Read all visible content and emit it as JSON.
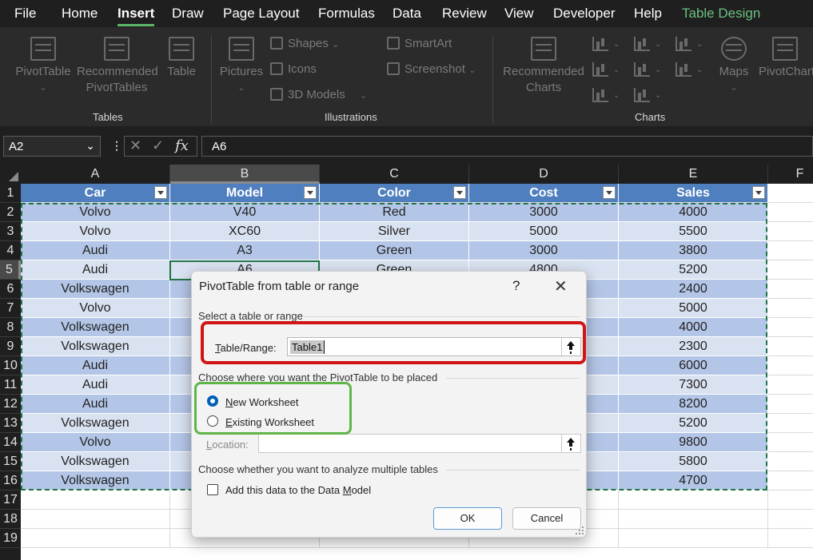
{
  "menu": {
    "tabs": [
      "File",
      "Home",
      "Insert",
      "Draw",
      "Page Layout",
      "Formulas",
      "Data",
      "Review",
      "View",
      "Developer",
      "Help",
      "Table Design"
    ],
    "active": "Insert"
  },
  "ribbon": {
    "pivottable_label": "PivotTable",
    "recommended_pivottables_line1": "Recommended",
    "recommended_pivottables_line2": "PivotTables",
    "table_label": "Table",
    "tables_group": "Tables",
    "pictures_label": "Pictures",
    "shapes_label": "Shapes",
    "icons_label": "Icons",
    "models_label": "3D Models",
    "smartart_label": "SmartArt",
    "screenshot_label": "Screenshot",
    "illustrations_group": "Illustrations",
    "recommended_charts_line1": "Recommended",
    "recommended_charts_line2": "Charts",
    "maps_label": "Maps",
    "pivotchart_label": "PivotChart",
    "charts_group": "Charts"
  },
  "formula_bar": {
    "name_box": "A2",
    "formula": "A6",
    "fx_label": "fx"
  },
  "sheet": {
    "columns": [
      "A",
      "B",
      "C",
      "D",
      "E",
      "F"
    ],
    "selected_column": "B",
    "rows": [
      "1",
      "2",
      "3",
      "4",
      "5",
      "6",
      "7",
      "8",
      "9",
      "10",
      "11",
      "12",
      "13",
      "14",
      "15",
      "16",
      "17",
      "18",
      "19"
    ],
    "selected_row": "5",
    "headers": [
      "Car",
      "Model",
      "Color",
      "Cost",
      "Sales"
    ],
    "data": [
      [
        "Volvo",
        "V40",
        "Red",
        "3000",
        "4000"
      ],
      [
        "Volvo",
        "XC60",
        "Silver",
        "5000",
        "5500"
      ],
      [
        "Audi",
        "A3",
        "Green",
        "3000",
        "3800"
      ],
      [
        "Audi",
        "A6",
        "Green",
        "4800",
        "5200"
      ],
      [
        "Volkswagen",
        "",
        "",
        "",
        "2400"
      ],
      [
        "Volvo",
        "",
        "",
        "",
        "5000"
      ],
      [
        "Volkswagen",
        "",
        "",
        "",
        "4000"
      ],
      [
        "Volkswagen",
        "",
        "",
        "",
        "2300"
      ],
      [
        "Audi",
        "",
        "",
        "",
        "6000"
      ],
      [
        "Audi",
        "",
        "",
        "",
        "7300"
      ],
      [
        "Audi",
        "",
        "",
        "",
        "8200"
      ],
      [
        "Volkswagen",
        "",
        "",
        "",
        "5200"
      ],
      [
        "Volvo",
        "",
        "",
        "",
        "9800"
      ],
      [
        "Volkswagen",
        "",
        "",
        "",
        "5800"
      ],
      [
        "Volkswagen",
        "",
        "",
        "",
        "4700"
      ]
    ]
  },
  "dialog": {
    "title": "PivotTable from table or range",
    "help": "?",
    "close": "✕",
    "section_select": "Select a table or range",
    "table_range_label": "Table/Range:",
    "table_range_value": "Table1",
    "section_place": "Choose where you want the PivotTable to be placed",
    "new_worksheet": "New Worksheet",
    "existing_worksheet": "Existing Worksheet",
    "location_label": "Location:",
    "section_multiple": "Choose whether you want to analyze multiple tables",
    "add_data_model": "Add this data to the Data Model",
    "ok": "OK",
    "cancel": "Cancel"
  },
  "colors": {
    "table_header": "#4f7fbf",
    "band_dark": "#b4c6e7",
    "band_light": "#d9e2f1",
    "highlight_red": "#d01515",
    "highlight_green": "#5fb547",
    "selection_green": "#217346"
  }
}
